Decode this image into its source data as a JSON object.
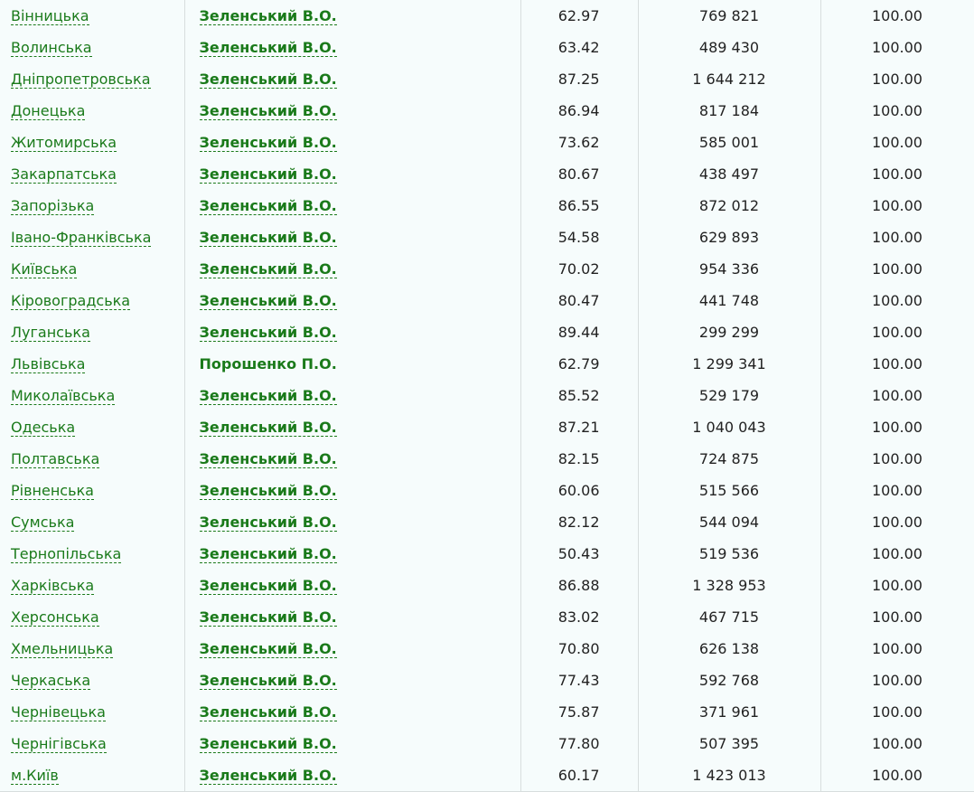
{
  "rows": [
    {
      "region": "Вінницька",
      "winner": "Зеленський В.О.",
      "winner_link": true,
      "pct": "62.97",
      "voters": "769 821",
      "processed": "100.00"
    },
    {
      "region": "Волинська",
      "winner": "Зеленський В.О.",
      "winner_link": true,
      "pct": "63.42",
      "voters": "489 430",
      "processed": "100.00"
    },
    {
      "region": "Дніпропетровська",
      "winner": "Зеленський В.О.",
      "winner_link": true,
      "pct": "87.25",
      "voters": "1 644 212",
      "processed": "100.00"
    },
    {
      "region": "Донецька",
      "winner": "Зеленський В.О.",
      "winner_link": true,
      "pct": "86.94",
      "voters": "817 184",
      "processed": "100.00"
    },
    {
      "region": "Житомирська",
      "winner": "Зеленський В.О.",
      "winner_link": true,
      "pct": "73.62",
      "voters": "585 001",
      "processed": "100.00"
    },
    {
      "region": "Закарпатська",
      "winner": "Зеленський В.О.",
      "winner_link": true,
      "pct": "80.67",
      "voters": "438 497",
      "processed": "100.00"
    },
    {
      "region": "Запорізька",
      "winner": "Зеленський В.О.",
      "winner_link": true,
      "pct": "86.55",
      "voters": "872 012",
      "processed": "100.00"
    },
    {
      "region": "Івано-Франківська",
      "winner": "Зеленський В.О.",
      "winner_link": true,
      "pct": "54.58",
      "voters": "629 893",
      "processed": "100.00"
    },
    {
      "region": "Київська",
      "winner": "Зеленський В.О.",
      "winner_link": true,
      "pct": "70.02",
      "voters": "954 336",
      "processed": "100.00"
    },
    {
      "region": "Кіровоградська",
      "winner": "Зеленський В.О.",
      "winner_link": true,
      "pct": "80.47",
      "voters": "441 748",
      "processed": "100.00"
    },
    {
      "region": "Луганська",
      "winner": "Зеленський В.О.",
      "winner_link": true,
      "pct": "89.44",
      "voters": "299 299",
      "processed": "100.00"
    },
    {
      "region": "Львівська",
      "winner": "Порошенко П.О.",
      "winner_link": false,
      "pct": "62.79",
      "voters": "1 299 341",
      "processed": "100.00"
    },
    {
      "region": "Миколаївська",
      "winner": "Зеленський В.О.",
      "winner_link": true,
      "pct": "85.52",
      "voters": "529 179",
      "processed": "100.00"
    },
    {
      "region": "Одеська",
      "winner": "Зеленський В.О.",
      "winner_link": true,
      "pct": "87.21",
      "voters": "1 040 043",
      "processed": "100.00"
    },
    {
      "region": "Полтавська",
      "winner": "Зеленський В.О.",
      "winner_link": true,
      "pct": "82.15",
      "voters": "724 875",
      "processed": "100.00"
    },
    {
      "region": "Рівненська",
      "winner": "Зеленський В.О.",
      "winner_link": true,
      "pct": "60.06",
      "voters": "515 566",
      "processed": "100.00"
    },
    {
      "region": "Сумська",
      "winner": "Зеленський В.О.",
      "winner_link": true,
      "pct": "82.12",
      "voters": "544 094",
      "processed": "100.00"
    },
    {
      "region": "Тернопільська",
      "winner": "Зеленський В.О.",
      "winner_link": true,
      "pct": "50.43",
      "voters": "519 536",
      "processed": "100.00"
    },
    {
      "region": "Харківська",
      "winner": "Зеленський В.О.",
      "winner_link": true,
      "pct": "86.88",
      "voters": "1 328 953",
      "processed": "100.00"
    },
    {
      "region": "Херсонська",
      "winner": "Зеленський В.О.",
      "winner_link": true,
      "pct": "83.02",
      "voters": "467 715",
      "processed": "100.00"
    },
    {
      "region": "Хмельницька",
      "winner": "Зеленський В.О.",
      "winner_link": true,
      "pct": "70.80",
      "voters": "626 138",
      "processed": "100.00"
    },
    {
      "region": "Черкаська",
      "winner": "Зеленський В.О.",
      "winner_link": true,
      "pct": "77.43",
      "voters": "592 768",
      "processed": "100.00"
    },
    {
      "region": "Чернівецька",
      "winner": "Зеленський В.О.",
      "winner_link": true,
      "pct": "75.87",
      "voters": "371 961",
      "processed": "100.00"
    },
    {
      "region": "Чернігівська",
      "winner": "Зеленський В.О.",
      "winner_link": true,
      "pct": "77.80",
      "voters": "507 395",
      "processed": "100.00"
    },
    {
      "region": "м.Київ",
      "winner": "Зеленський В.О.",
      "winner_link": true,
      "pct": "60.17",
      "voters": "1 423 013",
      "processed": "100.00"
    }
  ]
}
